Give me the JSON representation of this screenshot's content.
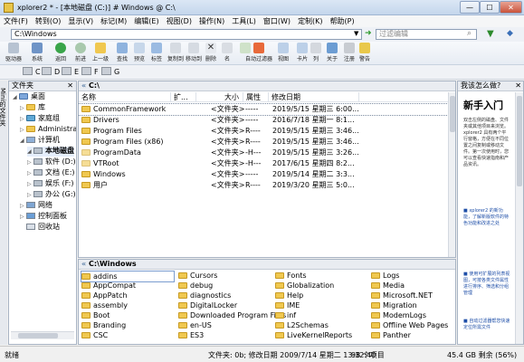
{
  "window": {
    "title": "xplorer2 * - [本地磁盘 (C:)] # Windows @ C:\\",
    "min": "—",
    "max": "☐",
    "close": "✕"
  },
  "menu": [
    "文件(F)",
    "转到(O)",
    "显示(V)",
    "标记(M)",
    "编辑(E)",
    "视图(D)",
    "操作(N)",
    "工具(L)",
    "窗口(W)",
    "定制(K)",
    "帮助(P)"
  ],
  "address": {
    "value": "C:\\Windows",
    "filter_placeholder": "过滤编辑"
  },
  "toolbar": [
    "驱动器",
    "系统",
    "返回",
    "前进",
    "上一级",
    "查找",
    "预览",
    "标签",
    "复制到",
    "移动到",
    "删除",
    "名",
    "",
    "自动过滤器",
    "视图",
    "卡片",
    "列",
    "关于",
    "注册",
    "警告"
  ],
  "drives": [
    "C",
    "D",
    "E",
    "F",
    "G"
  ],
  "tree": {
    "title": "文件夹",
    "items": [
      "桌面",
      "库",
      "家庭组",
      "Administrat",
      "计算机",
      "本地磁盘",
      "软件 (D:)",
      "文档 (E:)",
      "娱乐 (F:)",
      "办公 (G:)",
      "网络",
      "控制面板",
      "回收站"
    ]
  },
  "side_tab": "Mini的文件夹",
  "top_pane": {
    "path": "C:\\",
    "columns": [
      "名称",
      "扩...",
      "大小",
      "属性",
      "修改日期"
    ],
    "rows": [
      {
        "name": "CommonFramework",
        "size": "<文件夹>",
        "attr": "-----",
        "date": "2019/5/15 星期三 6:00..."
      },
      {
        "name": "Drivers",
        "size": "<文件夹>",
        "attr": "-----",
        "date": "2016/7/18 星期一 8:1..."
      },
      {
        "name": "Program Files",
        "size": "<文件夹>",
        "attr": "R----",
        "date": "2019/5/15 星期三 3:46..."
      },
      {
        "name": "Program Files (x86)",
        "size": "<文件夹>",
        "attr": "R----",
        "date": "2019/5/15 星期三 3:46..."
      },
      {
        "name": "ProgramData",
        "size": "<文件夹>",
        "attr": "-H---",
        "date": "2019/5/15 星期三 3:26..."
      },
      {
        "name": "VTRoot",
        "size": "<文件夹>",
        "attr": "-H---",
        "date": "2017/6/15 星期四 8:2..."
      },
      {
        "name": "Windows",
        "size": "<文件夹>",
        "attr": "-----",
        "date": "2019/5/14 星期二 3:3..."
      },
      {
        "name": "用户",
        "size": "<文件夹>",
        "attr": "R----",
        "date": "2019/3/20 星期三 5:0..."
      }
    ]
  },
  "bottom_pane": {
    "path": "C:\\Windows",
    "columns": [
      [
        "addins",
        "AppCompat",
        "AppPatch",
        "assembly",
        "Boot",
        "Branding",
        "CSC"
      ],
      [
        "Cursors",
        "debug",
        "diagnostics",
        "DigitalLocker",
        "Downloaded Program Files",
        "en-US",
        "ES3"
      ],
      [
        "Fonts",
        "Globalization",
        "Help",
        "IME",
        "inf",
        "L2Schemas",
        "LiveKernelReports"
      ],
      [
        "Logs",
        "Media",
        "Microsoft.NET",
        "Migration",
        "ModemLogs",
        "Offline Web Pages",
        "Panther"
      ]
    ]
  },
  "preview": {
    "header": "我该怎么做?",
    "title": "新手入门",
    "intro": "双击左侧的磁盘、文件夹或其他项目来浏览。xplorer2 具有两个平行窗格，方便在不同位置之间复制或移动文件。第一次使用时，您可以查看快速指南和产品资讯。",
    "items": [
      "xplorer2 的新功能，了解新版软件的特色功能和改进之处",
      "使用可扩展的列表视图，可按各类文件属性进行排序、筛选和分组管理",
      "自动过滤器帮您快速定位所需文件"
    ]
  },
  "status": {
    "left": "就绪",
    "info": "文件夹: 0b; 修改日期 2009/7/14 星期二 13:32:40",
    "count": "98 个项目",
    "free": "45.4 GB 剩余 (56%)"
  }
}
